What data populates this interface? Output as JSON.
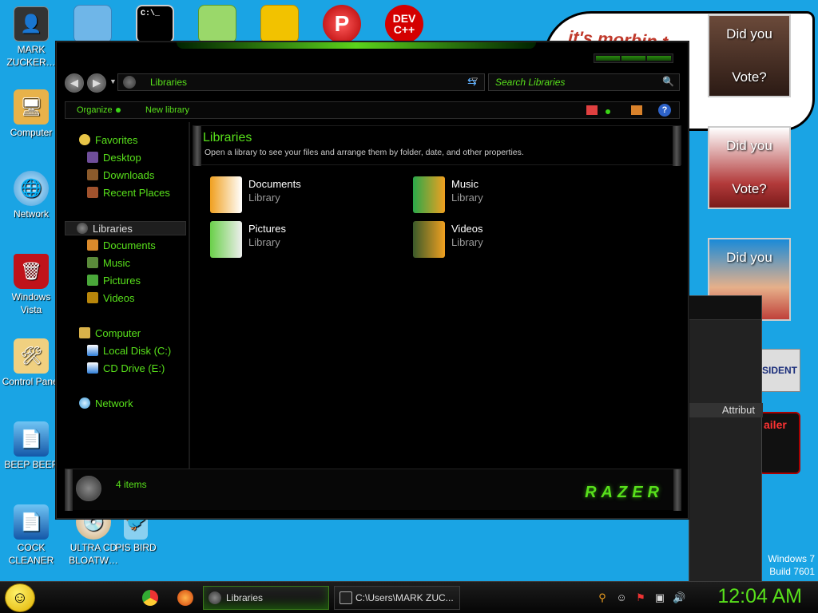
{
  "desktop": {
    "icons": [
      {
        "label": "MARK ZUCKER…",
        "icon": "user-folder-icon"
      },
      {
        "label": "Computer",
        "icon": "computer-icon"
      },
      {
        "label": "Network",
        "icon": "network-globe-icon"
      },
      {
        "label": "Windows Vista",
        "icon": "recycle-bin-icon"
      },
      {
        "label": "Control Panel",
        "icon": "control-panel-icon"
      },
      {
        "label": "BEEP BEEP",
        "icon": "file-icon"
      },
      {
        "label": "COCK CLEANER",
        "icon": "file-icon"
      },
      {
        "label": "ULTRA CD BLOATW…",
        "icon": "cd-icon"
      },
      {
        "label": "PIS BIRD",
        "icon": "game-icon"
      }
    ],
    "top_icons": [
      {
        "name": "folder-note-icon",
        "label": ""
      },
      {
        "name": "cmd-icon",
        "label": "C:\\_"
      },
      {
        "name": "drive-icon",
        "label": ""
      },
      {
        "name": "angry-bird-icon",
        "label": ""
      },
      {
        "name": "paint-icon",
        "label": "P"
      },
      {
        "name": "devcpp-icon",
        "label": "DEV C++"
      }
    ],
    "speech_text": "it's morbin t",
    "vote_photos": [
      {
        "line1": "Did you",
        "line2": "Vote?"
      },
      {
        "line1": "Did you",
        "line2": "Vote?"
      },
      {
        "line1": "Did you",
        "line2": "?"
      }
    ],
    "president_badge": "SIDENT",
    "ad_text": "ailer",
    "background_window_label": "Attribut",
    "windows_edition": "Windows 7",
    "build": "Build 7601"
  },
  "explorer": {
    "address": "Libraries",
    "search_placeholder": "Search Libraries",
    "commands": {
      "organize": "Organize",
      "new_library": "New library"
    },
    "nav": {
      "favorites": "Favorites",
      "desktop": "Desktop",
      "downloads": "Downloads",
      "recent_places": "Recent Places",
      "libraries": "Libraries",
      "documents": "Documents",
      "music": "Music",
      "pictures": "Pictures",
      "videos": "Videos",
      "computer": "Computer",
      "local_disk": "Local Disk (C:)",
      "cd_drive": "CD Drive (E:)",
      "network": "Network"
    },
    "header": {
      "title": "Libraries",
      "subtitle": "Open a library to see your files and arrange them by folder, date, and other properties."
    },
    "libraries": [
      {
        "name": "Documents",
        "type": "Library"
      },
      {
        "name": "Music",
        "type": "Library"
      },
      {
        "name": "Pictures",
        "type": "Library"
      },
      {
        "name": "Videos",
        "type": "Library"
      }
    ],
    "item_count": "4 items",
    "brand_logo": "RAZER"
  },
  "taskbar": {
    "tasks": [
      {
        "label": "Libraries"
      },
      {
        "label": "C:\\Users\\MARK ZUC..."
      }
    ],
    "clock": "12:04 AM"
  },
  "colors": {
    "accent": "#58e01b",
    "desktop": "#1aa4e4"
  }
}
